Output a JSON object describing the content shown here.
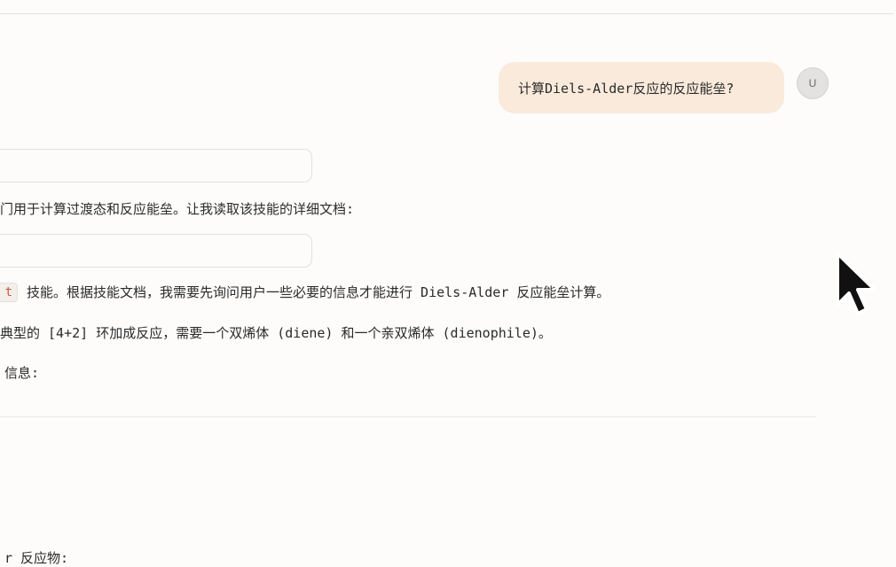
{
  "conversation": {
    "user_message": "计算Diels-Alder反应的反应能垒?",
    "user_avatar_initial": "U",
    "assistant_lines": [
      "门用于计算过渡态和反应能垒。让我读取该技能的详细文档:",
      "技能。根据技能文档，我需要先询问用户一些必要的信息才能进行 Diels-Alder 反应能垒计算。",
      "典型的 [4+2] 环加成反应，需要一个双烯体 (diene) 和一个亲双烯体 (dienophile)。",
      "信息:",
      "r 反应物:"
    ],
    "inline_code_fragment": "t"
  }
}
